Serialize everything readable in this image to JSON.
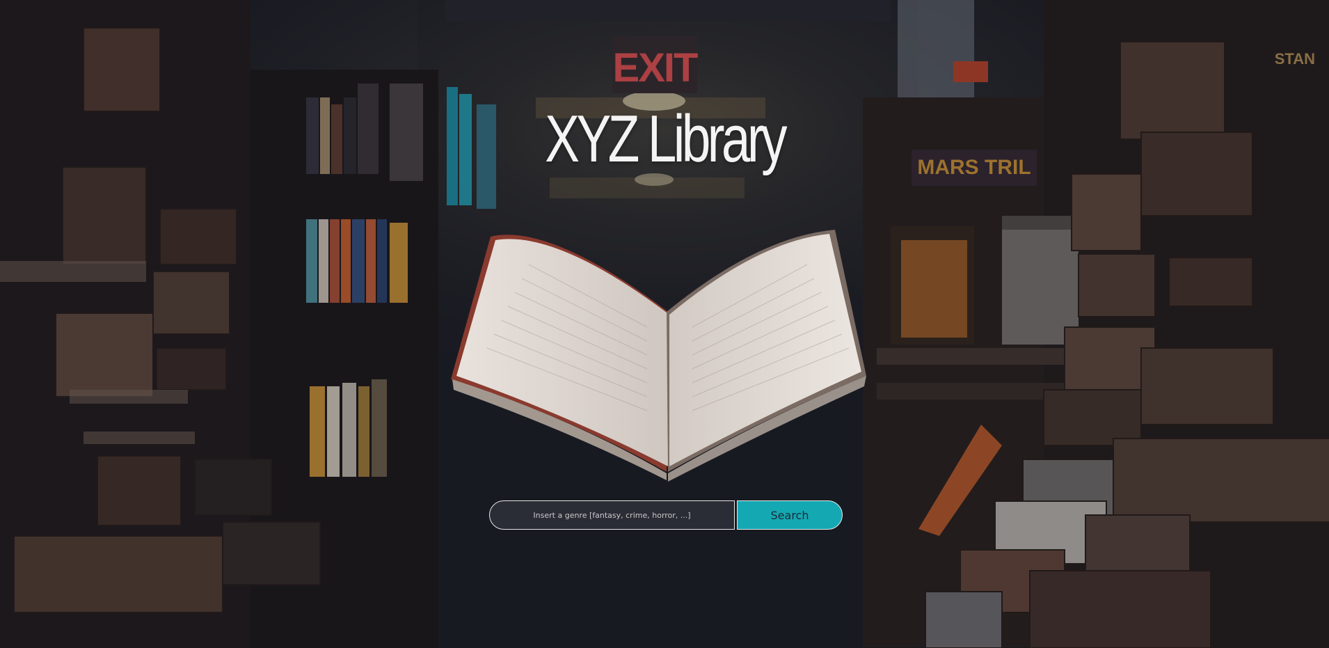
{
  "page": {
    "title": "XYZ Library",
    "background_scene": "library-bookshelves-with-floating-book",
    "exit_sign_text": "EXIT"
  },
  "search": {
    "placeholder": "Insert a genre [fantasy, crime, horror, ...]",
    "value": "",
    "button_label": "Search"
  },
  "colors": {
    "button_bg": "#14a8b3",
    "input_bg": "#2a2d36",
    "title": "#f4f4f4",
    "exit_sign": "#ff5a5a"
  }
}
